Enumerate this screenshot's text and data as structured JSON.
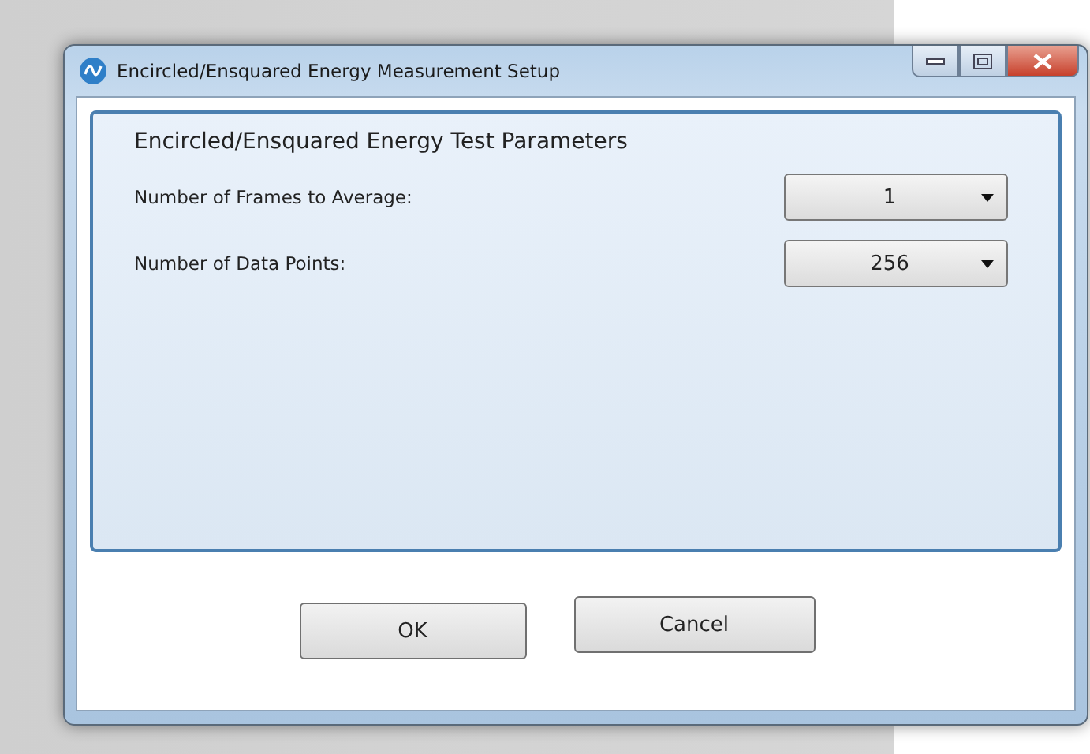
{
  "window": {
    "title": "Encircled/Ensquared Energy Measurement Setup"
  },
  "group": {
    "title": "Encircled/Ensquared Energy Test Parameters"
  },
  "fields": [
    {
      "label": "Number of Frames to Average:",
      "value": "1"
    },
    {
      "label": "Number of Data Points:",
      "value": "256"
    }
  ],
  "buttons": [
    "OK",
    "Cancel"
  ]
}
